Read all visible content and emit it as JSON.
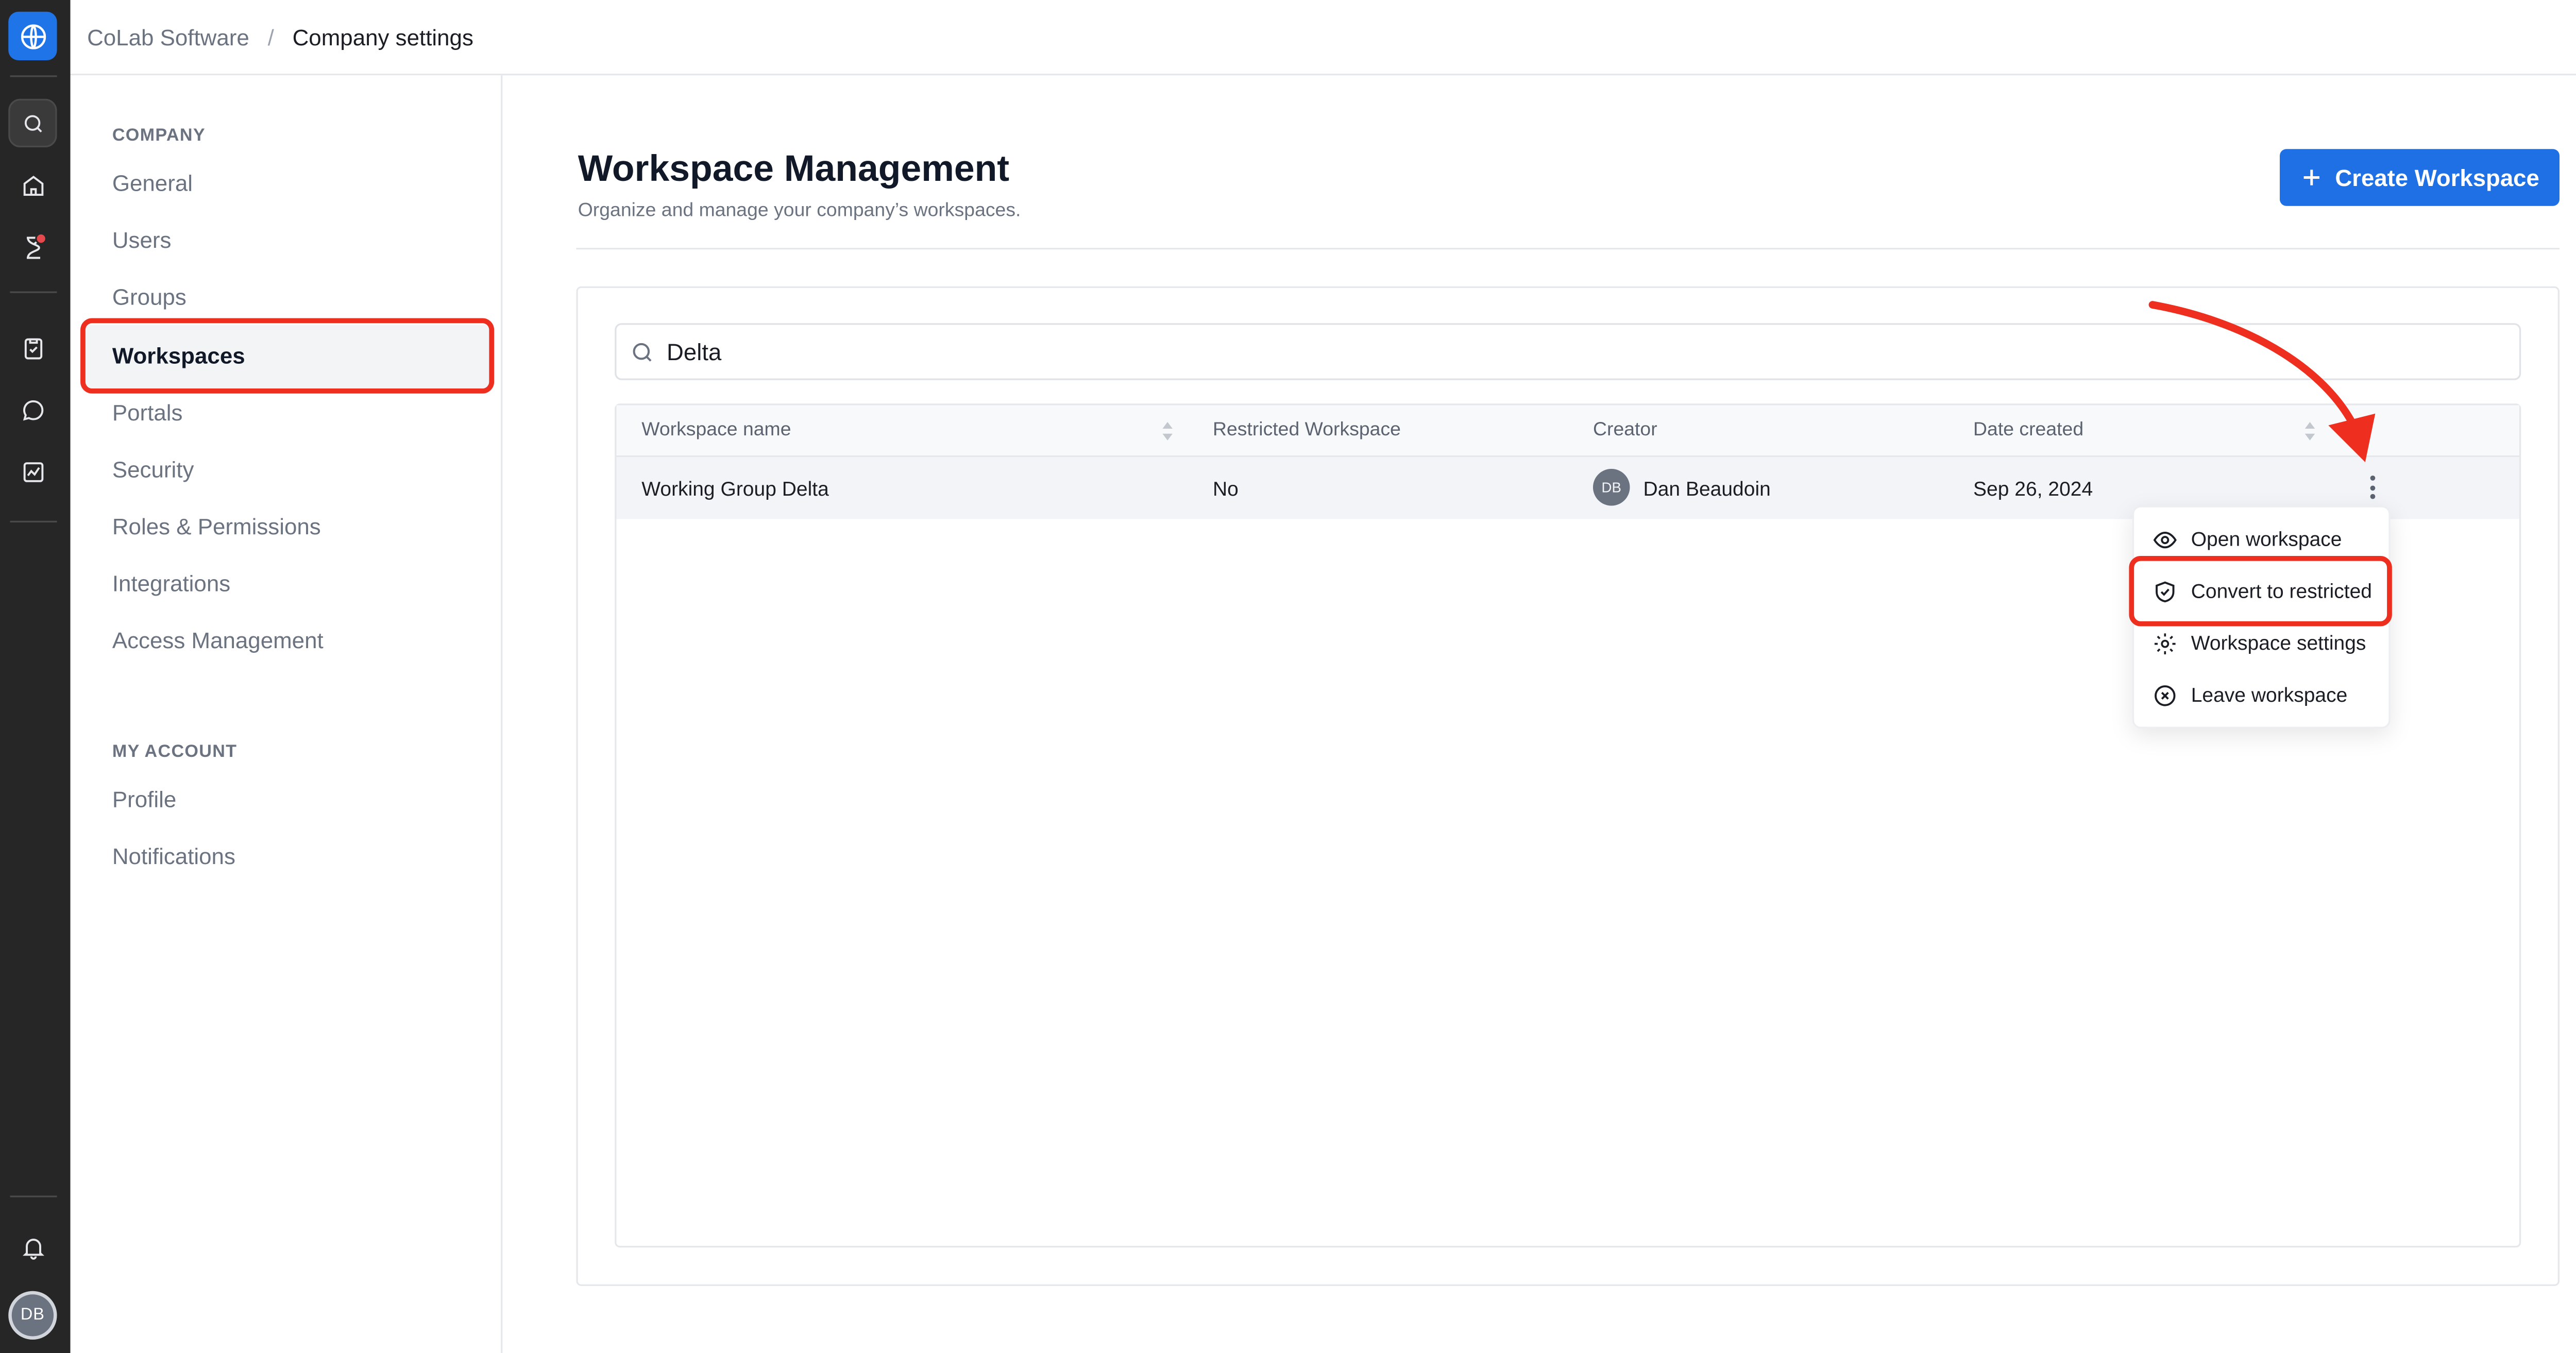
{
  "breadcrumb": {
    "parent": "CoLab Software",
    "separator": "/",
    "current": "Company settings"
  },
  "rail": {
    "avatar_initials": "DB"
  },
  "nav": {
    "company_heading": "COMPANY",
    "company_items": [
      "General",
      "Users",
      "Groups",
      "Workspaces",
      "Portals",
      "Security",
      "Roles & Permissions",
      "Integrations",
      "Access Management"
    ],
    "account_heading": "MY ACCOUNT",
    "account_items": [
      "Profile",
      "Notifications"
    ],
    "active": "Workspaces"
  },
  "page": {
    "title": "Workspace Management",
    "subtitle": "Organize and manage your company’s workspaces.",
    "create_button": "Create Workspace"
  },
  "search": {
    "value": "Delta"
  },
  "table": {
    "columns": [
      "Workspace name",
      "Restricted Workspace",
      "Creator",
      "Date created"
    ],
    "rows": [
      {
        "name": "Working Group Delta",
        "restricted": "No",
        "creator_initials": "DB",
        "creator": "Dan Beaudoin",
        "date": "Sep 26, 2024"
      }
    ]
  },
  "menu": {
    "items": [
      {
        "label": "Open workspace",
        "icon": "eye-icon"
      },
      {
        "label": "Convert to restricted",
        "icon": "shield-check-icon"
      },
      {
        "label": "Workspace settings",
        "icon": "gear-icon"
      },
      {
        "label": "Leave workspace",
        "icon": "x-circle-icon"
      }
    ],
    "highlighted": "Convert to restricted"
  },
  "colors": {
    "accent": "#1f6fe5",
    "rail": "#262626",
    "annotation": "#ee2e1f"
  }
}
